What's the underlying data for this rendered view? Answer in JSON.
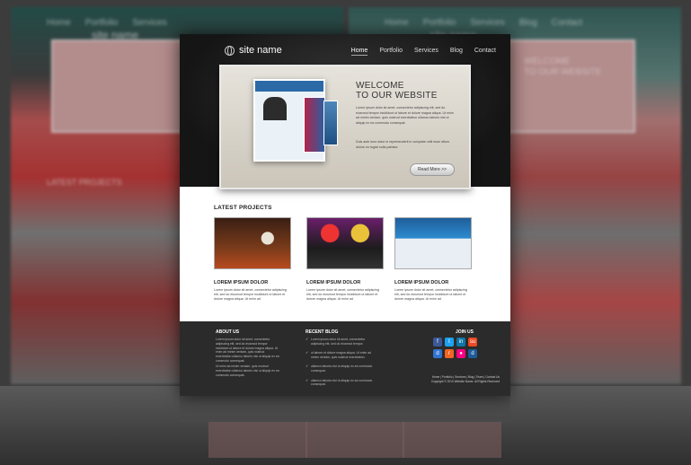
{
  "site": {
    "name": "site name",
    "nav": [
      "Home",
      "Portfolio",
      "Services",
      "Blog",
      "Contact"
    ],
    "active_nav": "Home"
  },
  "slider": {
    "heading_line1": "WELCOME",
    "heading_line2": "TO OUR WEBSITE",
    "paragraph1": "Lorem ipsum dolor sit amet, consectetur adipiscing elit, sed do eiusmod tempor incididunt ut labore et dolore magna aliqua. Ut enim ad minim veniam, quis nostrud exercitation ullamco laboris nisi ut aliquip ex ea commodo consequat.",
    "paragraph2": "Duis aute irure dolor in reprehenderit in voluptate velit esse cillum dolore eu fugiat nulla pariatur.",
    "button": "Read More >>"
  },
  "projects": {
    "title": "LATEST PROJECTS",
    "items": [
      {
        "title": "LOREM IPSUM DOLOR",
        "text": "Lorem ipsum dolor sit amet, consectetur adipiscing elit, sed do eiusmod tempor incididunt ut labore et dolore magna aliqua. Ut enim ad"
      },
      {
        "title": "LOREM IPSUM DOLOR",
        "text": "Lorem ipsum dolor sit amet, consectetur adipiscing elit, sed do eiusmod tempor incididunt ut labore et dolore magna aliqua. Ut enim ad"
      },
      {
        "title": "LOREM IPSUM DOLOR",
        "text": "Lorem ipsum dolor sit amet, consectetur adipiscing elit, sed do eiusmod tempor incididunt ut labore et dolore magna aliqua. Ut enim ad"
      }
    ]
  },
  "footer": {
    "about_title": "ABOUT US",
    "about_text1": "Lorem ipsum dolor sit amet, consectetur adipiscing elit, sed do eiusmod tempor incididunt ut labore et dolore magna aliqua. Ut enim ad minim veniam, quis nostrud exercitation ullamco laboris nisi ut aliquip ex ea commodo consequat.",
    "about_text2": "Ut enim ad minim veniam, quis nostrud exercitation ullamco laboris nisi ut aliquip ex ea commodo consequat.",
    "blog_title": "RECENT BLOG",
    "blog_items": [
      "Lorem ipsum dolor sit amet, consectetur adipiscing elit, sed do eiusmod tempor.",
      "ut labore et dolore magna aliqua. Ut enim ad minim veniam, quis nostrud exercitation.",
      "ullamco laboris nisi ut aliquip ex ea commodo consequat.",
      "ullamco laboris nisi ut aliquip ex ea commodo consequat."
    ],
    "join_title": "JOIN US",
    "links": "Home | Portfolio | Services | Blog | Team | Contact Us",
    "copyright": "Copyright © 2010 Website Name. All Rights Reserved"
  },
  "social_icons": [
    {
      "name": "facebook-icon",
      "color": "#3b5998",
      "glyph": "f"
    },
    {
      "name": "twitter-icon",
      "color": "#1da1f2",
      "glyph": "t"
    },
    {
      "name": "linkedin-icon",
      "color": "#0e76a8",
      "glyph": "in"
    },
    {
      "name": "stumbleupon-icon",
      "color": "#eb4924",
      "glyph": "su"
    },
    {
      "name": "delicious-icon",
      "color": "#3274d1",
      "glyph": "d"
    },
    {
      "name": "rss-icon",
      "color": "#f26522",
      "glyph": "r"
    },
    {
      "name": "flickr-icon",
      "color": "#ff0084",
      "glyph": "●"
    },
    {
      "name": "digg-icon",
      "color": "#1e5b9b",
      "glyph": "d"
    }
  ]
}
